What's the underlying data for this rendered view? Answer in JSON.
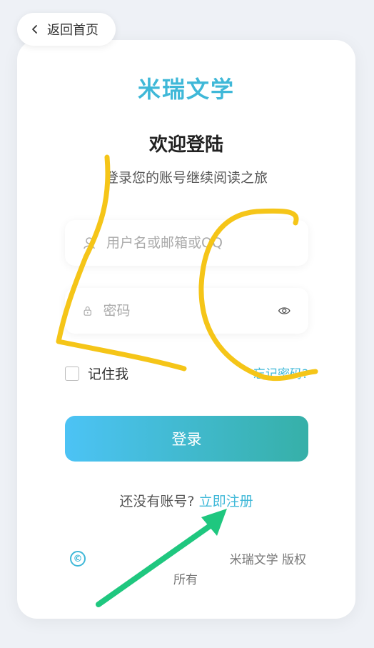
{
  "back": {
    "label": "返回首页",
    "icon": "chevron-left-icon"
  },
  "brand": {
    "name": "米瑞文学",
    "color": "#3fb8d8"
  },
  "header": {
    "title": "欢迎登陆",
    "subtitle": "登录您的账号继续阅读之旅"
  },
  "form": {
    "username": {
      "placeholder": "用户名或邮箱或QQ",
      "value": "",
      "icon": "user-icon"
    },
    "password": {
      "placeholder": "密码",
      "value": "",
      "icon": "lock-icon",
      "toggle_icon": "eye-icon"
    },
    "remember_label": "记住我",
    "forgot_label": "忘记密码?",
    "login_label": "登录"
  },
  "register": {
    "prompt": "还没有账号?",
    "link": "立即注册"
  },
  "footer": {
    "copyright_symbol": "©",
    "line1": "米瑞文学 版权",
    "line2": "所有"
  },
  "colors": {
    "accent": "#3fb8d8",
    "gradient_start": "#4cc3f5",
    "gradient_end": "#36b0a8",
    "annotation_yellow": "#f5c518",
    "annotation_green": "#1fc77f"
  }
}
